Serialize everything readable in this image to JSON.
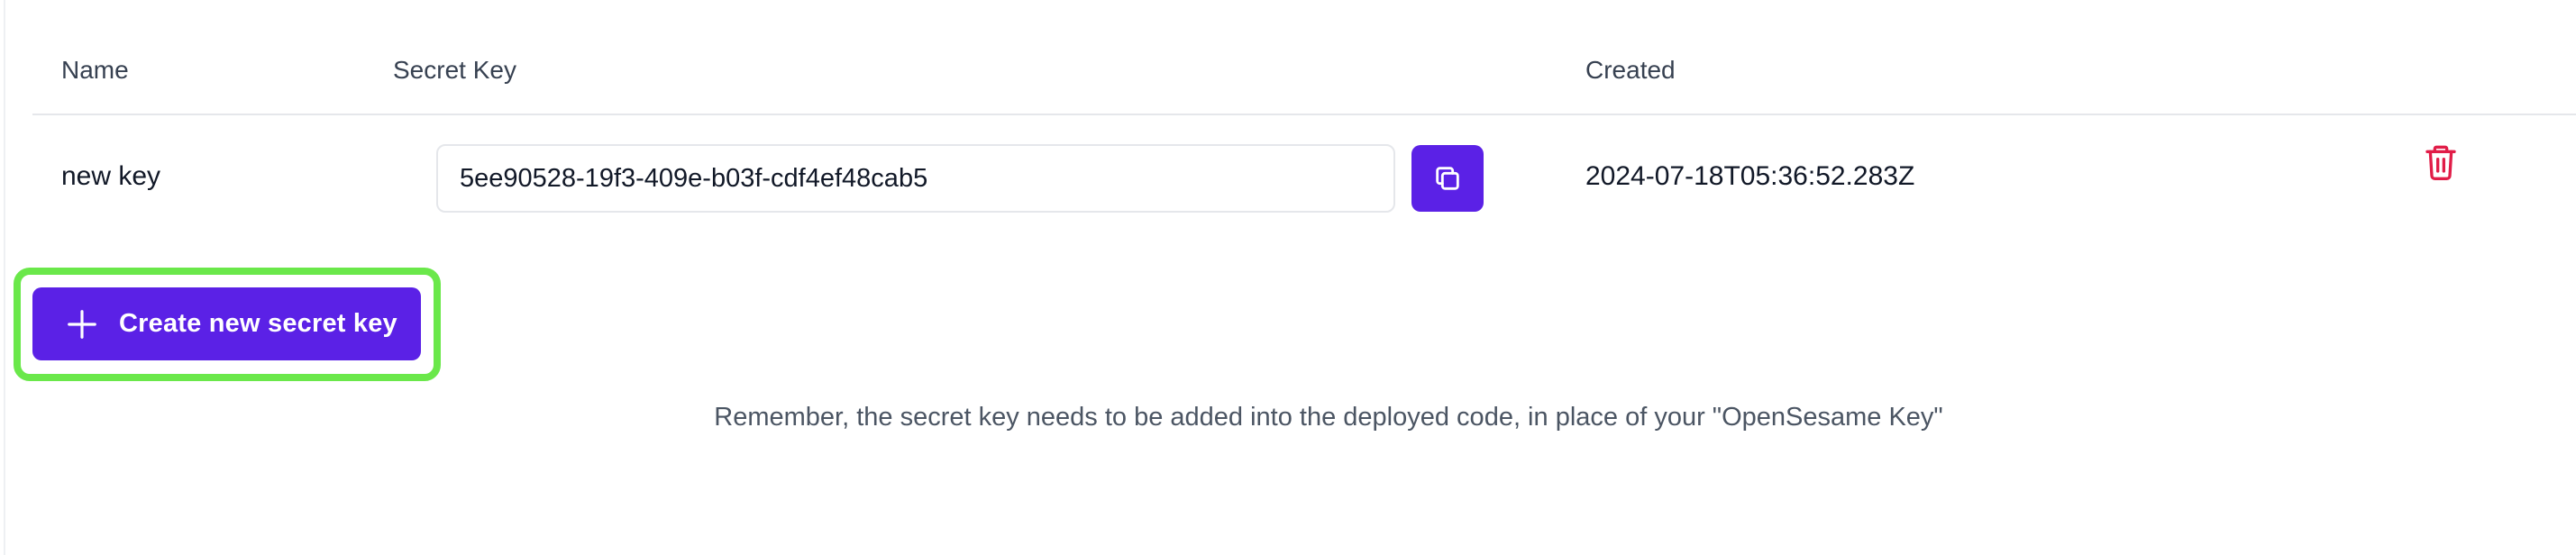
{
  "table": {
    "headers": {
      "name": "Name",
      "secret_key": "Secret Key",
      "created": "Created"
    },
    "rows": [
      {
        "name": "new key",
        "secret_key": "5ee90528-19f3-409e-b03f-cdf4ef48cab5",
        "created": "2024-07-18T05:36:52.283Z"
      }
    ]
  },
  "actions": {
    "create_label": "Create new secret key"
  },
  "note": "Remember, the secret key needs to be added into the deployed code, in place of your \"OpenSesame Key\"",
  "icons": {
    "copy": "copy-icon",
    "delete": "trash-icon",
    "add": "plus-icon"
  },
  "colors": {
    "accent": "#5b21e6",
    "danger": "#e11d48",
    "highlight": "#6ae84a"
  }
}
